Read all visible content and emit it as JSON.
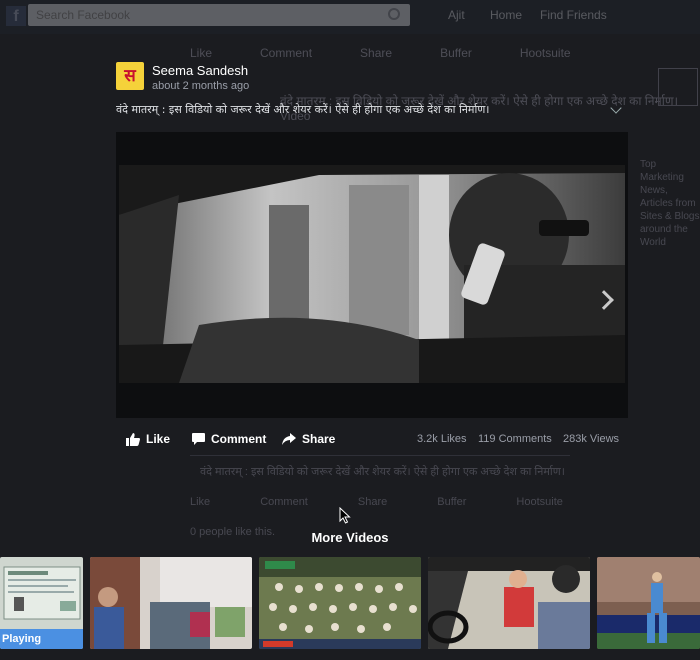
{
  "background": {
    "search_placeholder": "Search Facebook",
    "nav_items": [
      "Ajit",
      "Home",
      "Find Friends"
    ],
    "actions": [
      "Like",
      "Comment",
      "Share",
      "Buffer",
      "Hootsuite"
    ],
    "caption": "वंदे मातरम् : इस विडियो को जरूर देखें और शेयर करें। ऐसे ही होगा एक अच्छे देश का निर्माण। Video",
    "comment_text": "वंदे मातरम् : इस विडियो को जरूर देखें और शेयर करें। ऐसे ही होगा एक अच्छे देश का निर्माण।",
    "actions2": [
      "Like",
      "Comment",
      "Share",
      "Buffer",
      "Hootsuite"
    ],
    "seen_text": "0 people like this.",
    "right_text": "Top Marketing News, Articles from Sites & Blogs around the World"
  },
  "post": {
    "avatar_char": "स",
    "author": "Seema Sandesh",
    "time": "about 2 months ago",
    "caption": "वंदे मातरम् : इस विडियो को जरूर देखें और शेयर करें। ऐसे ही होगा एक अच्छे देश का निर्माण।"
  },
  "actions": {
    "like": "Like",
    "comment": "Comment",
    "share": "Share"
  },
  "stats": {
    "likes": "3.2k Likes",
    "comments": "119 Comments",
    "views": "283k Views"
  },
  "more_videos": {
    "title": "More Videos",
    "playing_label": "Playing",
    "thumbnails": [
      "document",
      "classroom",
      "parliament",
      "car-scene",
      "cricket"
    ]
  },
  "colors": {
    "background": "#1b1c20",
    "playing_blue": "#4b90e2",
    "avatar_yellow": "#f5d23a"
  }
}
